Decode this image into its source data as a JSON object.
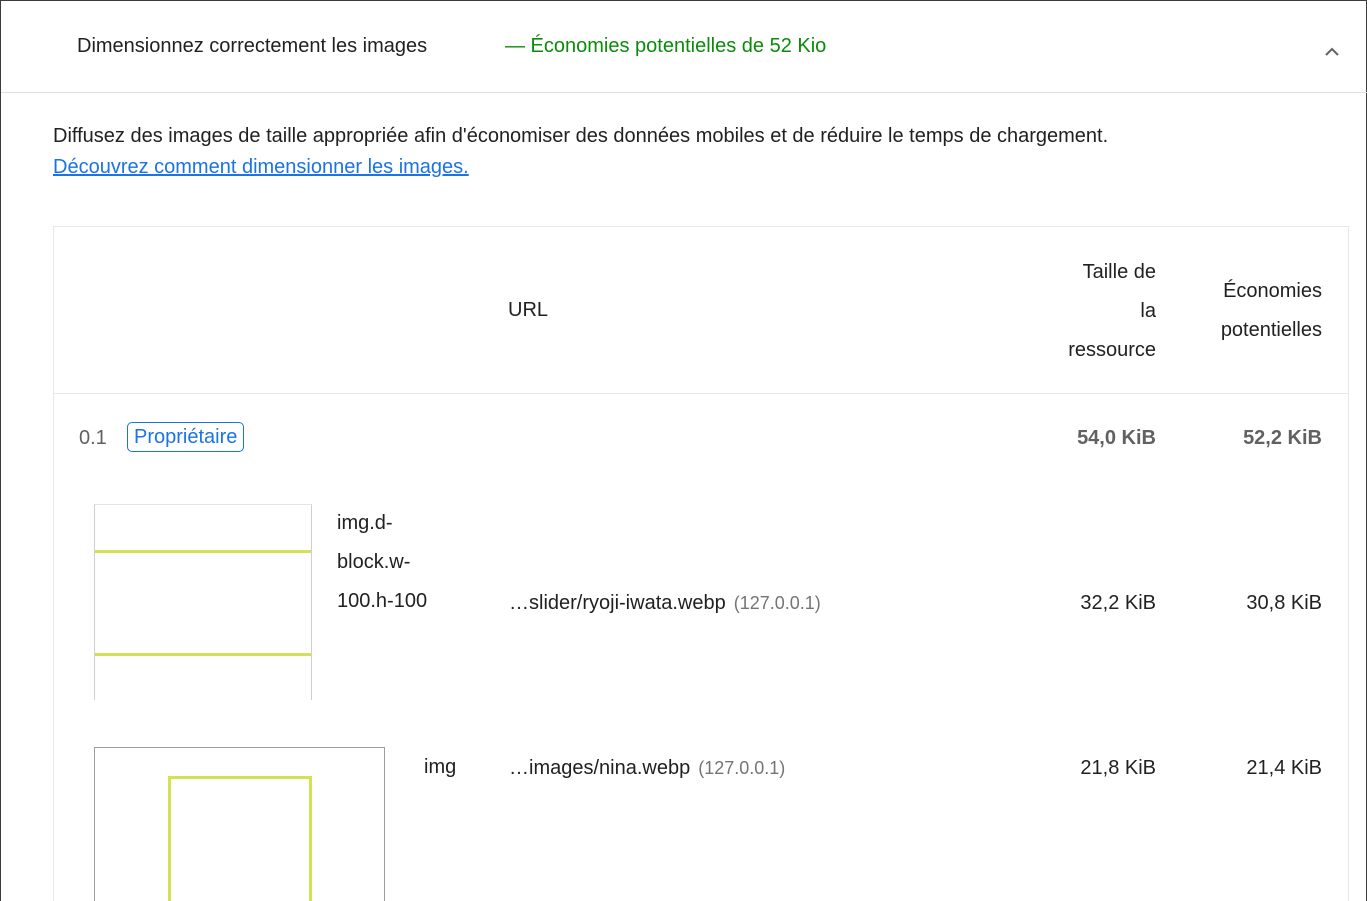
{
  "audit": {
    "title": "Dimensionnez correctement les images",
    "savings": "— Économies potentielles de 52 Kio",
    "description": "Diffusez des images de taille appropriée afin d'économiser des données mobiles et de réduire le temps de chargement.",
    "learn_more": "Découvrez comment dimensionner les images."
  },
  "table": {
    "headers": {
      "url": "URL",
      "size_line1": "Taille de",
      "size_line2": "la",
      "size_line3": "ressource",
      "savings_line1": "Économies",
      "savings_line2": "potentielles"
    },
    "group": {
      "number": "0.1",
      "badge": "Propriétaire",
      "size": "54,0 KiB",
      "savings": "52,2 KiB"
    },
    "rows": [
      {
        "node_line1": "img.d-",
        "node_line2": "block.w-",
        "node_line3": "100.h-100",
        "url": "…slider/ryoji-iwata.webp",
        "host": "(127.0.0.1)",
        "size": "32,2 KiB",
        "savings": "30,8 KiB"
      },
      {
        "node": "img",
        "url": "…images/nina.webp",
        "host": "(127.0.0.1)",
        "size": "21,8 KiB",
        "savings": "21,4 KiB"
      }
    ]
  },
  "colors": {
    "savings_green": "#0c8a0c",
    "link_blue": "#1a73e8",
    "thumbnail_accent": "#d4e157"
  },
  "icons": {
    "collapse": "chevron-up-icon"
  }
}
